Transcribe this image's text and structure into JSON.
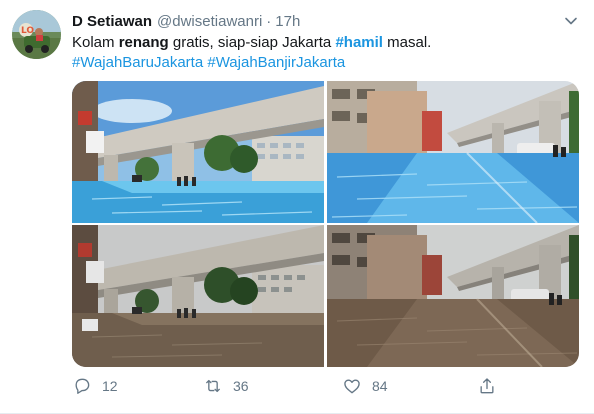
{
  "tweet": {
    "name": "D Setiawan",
    "handle": "@dwisetiawanri",
    "separator": "·",
    "time": "17h",
    "text": {
      "t1": "Kolam ",
      "t2": "renang",
      "t3": " gratis, siap-siap Jakarta ",
      "t4": "#hamil",
      "t5": " masal.",
      "h1": "#WajahBaruJakarta",
      "h2": "#WajahBanjirJakarta"
    },
    "stats": {
      "replies": "12",
      "retweets": "36",
      "likes": "84"
    }
  },
  "icons": [
    "avatar",
    "chevron-down-icon",
    "reply-icon",
    "retweet-icon",
    "like-icon",
    "share-icon"
  ],
  "colors": {
    "link": "#1b95e0",
    "muted": "#657786",
    "text": "#14171a",
    "pool_water": "#5bb8e8",
    "flood_water": "#7a6a58"
  }
}
